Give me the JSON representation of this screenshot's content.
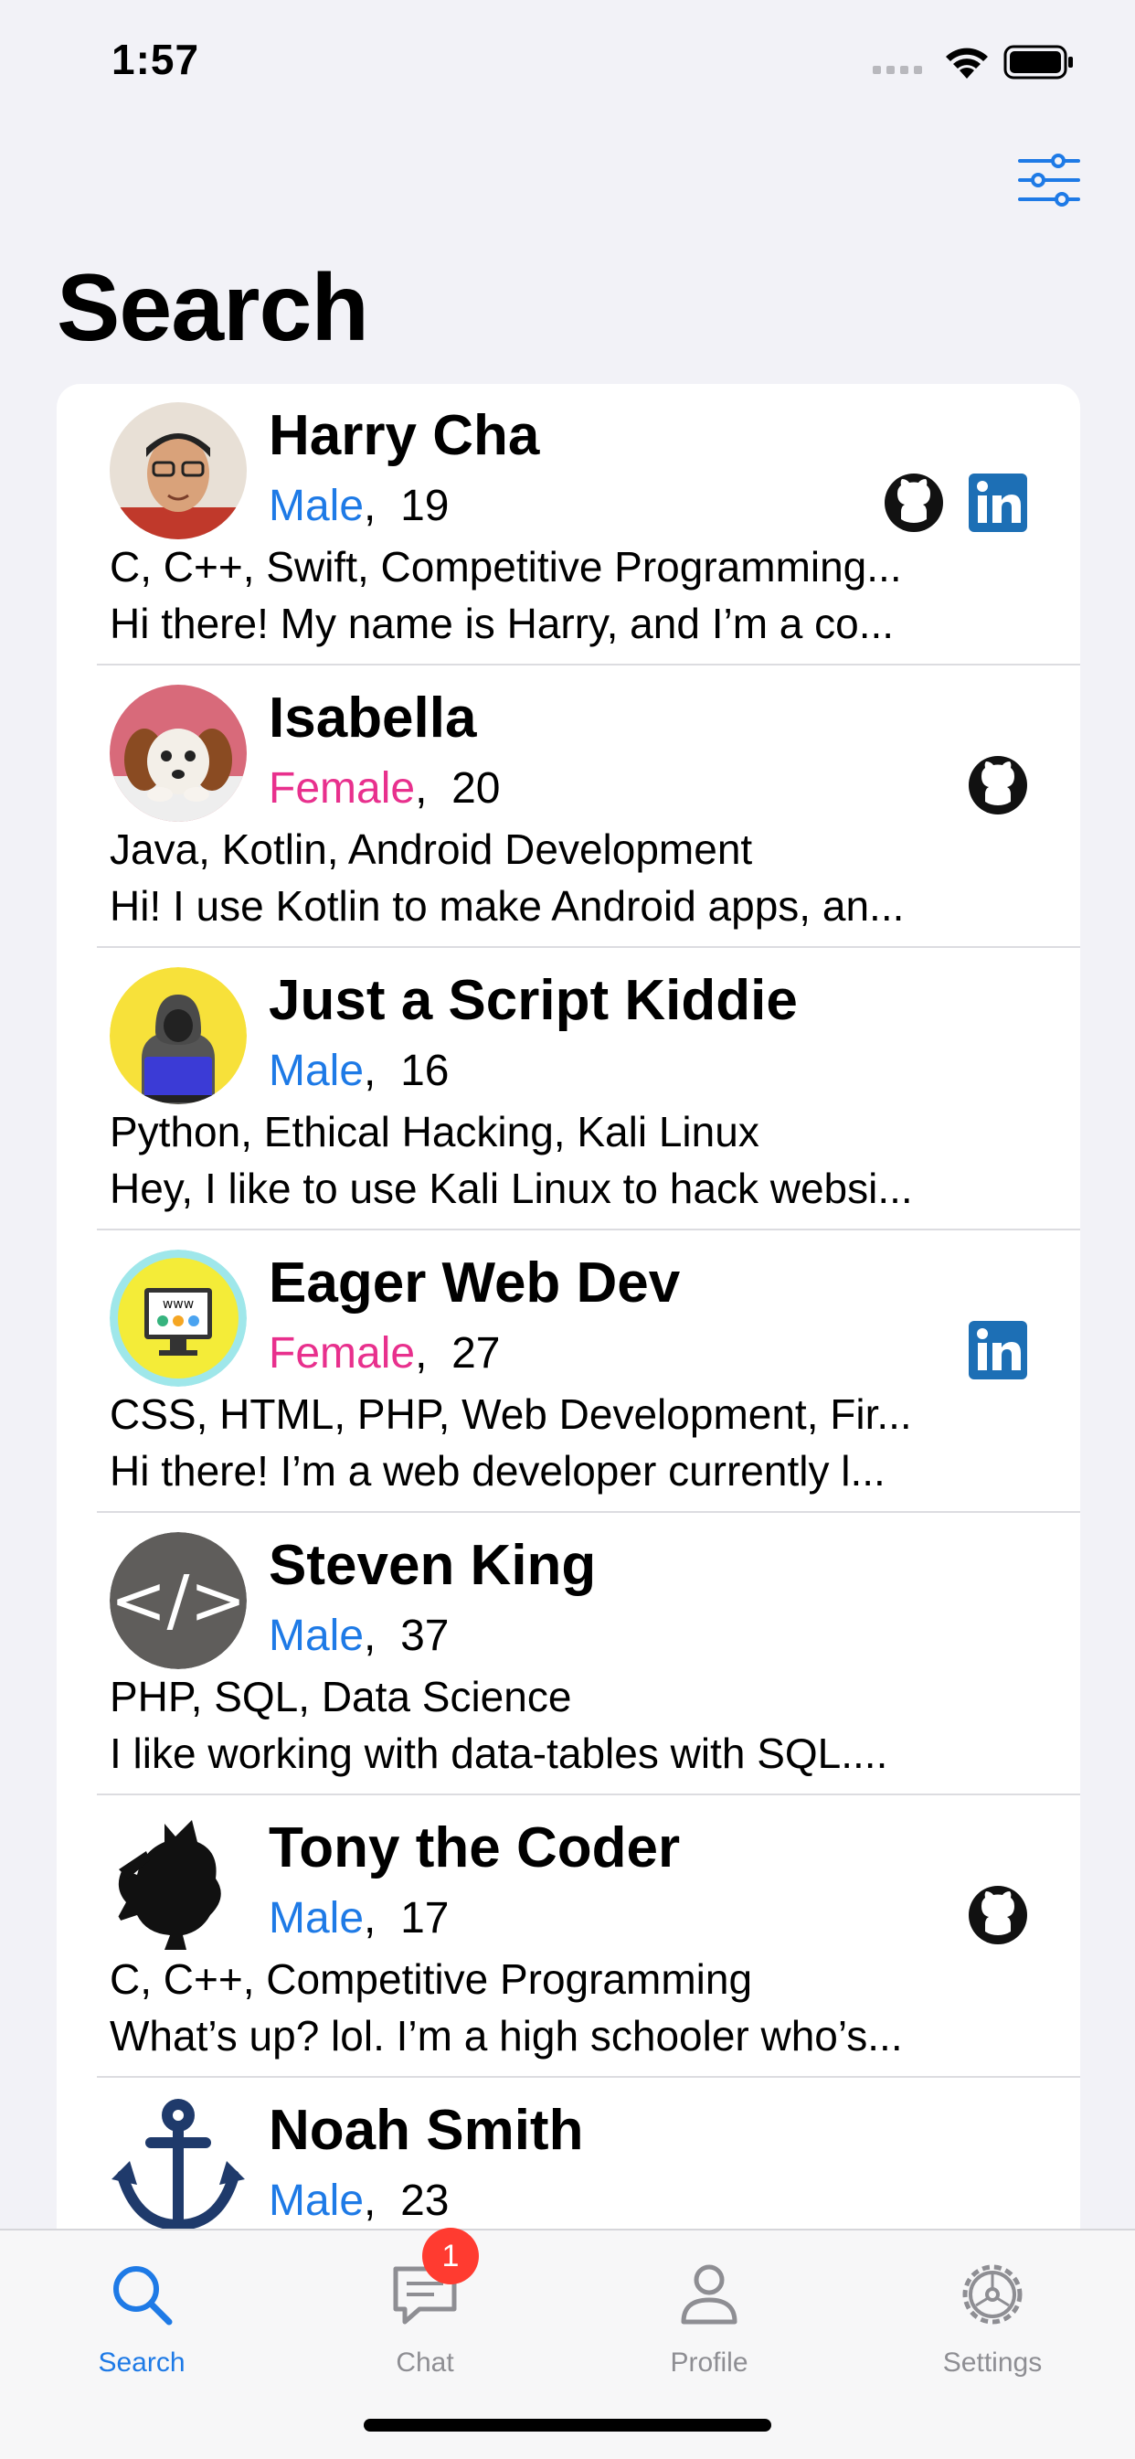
{
  "status_bar": {
    "time": "1:57"
  },
  "page": {
    "title": "Search"
  },
  "colors": {
    "accent": "#1e7ae6",
    "female": "#e8308d",
    "badge": "#ff3b30"
  },
  "users": [
    {
      "name": "Harry Cha",
      "gender": "Male",
      "age": "19",
      "sep": ",",
      "skills": "C, C++, Swift, Competitive Programming...",
      "bio": "Hi there! My name is Harry, and I’m a co...",
      "links": [
        "github",
        "linkedin"
      ]
    },
    {
      "name": "Isabella",
      "gender": "Female",
      "age": "20",
      "sep": ",",
      "skills": "Java, Kotlin, Android Development",
      "bio": "Hi! I use Kotlin to make Android apps, an...",
      "links": [
        "github"
      ]
    },
    {
      "name": "Just a Script Kiddie",
      "gender": "Male",
      "age": "16",
      "sep": ",",
      "skills": "Python, Ethical Hacking, Kali Linux",
      "bio": "Hey, I like to use Kali Linux to hack websi...",
      "links": []
    },
    {
      "name": "Eager Web Dev",
      "gender": "Female",
      "age": "27",
      "sep": ",",
      "skills": "CSS, HTML, PHP, Web Development, Fir...",
      "bio": "Hi there! I’m a web developer currently l...",
      "links": [
        "linkedin"
      ]
    },
    {
      "name": "Steven King",
      "gender": "Male",
      "age": "37",
      "sep": ",",
      "skills": "PHP, SQL, Data Science",
      "bio": "I like working with data-tables with SQL....",
      "links": []
    },
    {
      "name": "Tony the Coder",
      "gender": "Male",
      "age": "17",
      "sep": ",",
      "skills": "C, C++, Competitive Programming",
      "bio": "What’s up? lol. I’m a high schooler who’s...",
      "links": [
        "github"
      ]
    },
    {
      "name": "Noah Smith",
      "gender": "Male",
      "age": "23",
      "sep": ",",
      "skills": "",
      "bio": "",
      "links": []
    }
  ],
  "avatar_code_glyph": "</>",
  "avatar_www_text": "www",
  "tabs": [
    {
      "label": "Search",
      "icon": "search-icon",
      "active": true
    },
    {
      "label": "Chat",
      "icon": "chat-icon",
      "active": false
    },
    {
      "label": "Profile",
      "icon": "profile-icon",
      "active": false
    },
    {
      "label": "Settings",
      "icon": "settings-icon",
      "active": false
    }
  ],
  "chat_badge": "1"
}
